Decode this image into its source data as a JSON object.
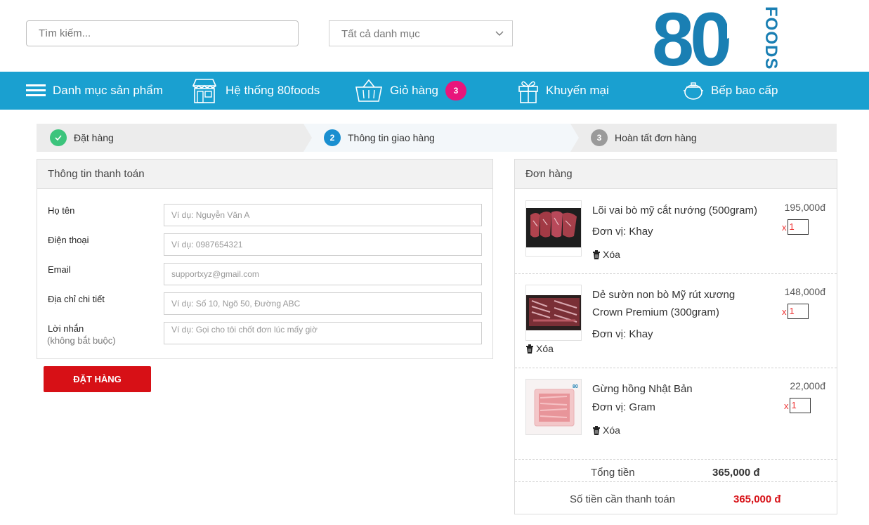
{
  "header": {
    "search_placeholder": "Tìm kiếm...",
    "category_select": "Tất cả danh mục",
    "logo_number": "80",
    "logo_word": "FOODS"
  },
  "nav": {
    "categories": "Danh mục sản phẩm",
    "stores": "Hệ thống 80foods",
    "cart": "Giỏ hàng",
    "cart_count": "3",
    "promotions": "Khuyến mại",
    "kitchen": "Bếp bao cấp"
  },
  "steps": [
    {
      "number": "✓",
      "label": "Đặt hàng"
    },
    {
      "number": "2",
      "label": "Thông tin giao hàng"
    },
    {
      "number": "3",
      "label": "Hoàn tất đơn hàng"
    }
  ],
  "payment": {
    "title": "Thông tin thanh toán",
    "fields": [
      {
        "label": "Họ tên",
        "placeholder": "Ví dụ: Nguyễn Văn A"
      },
      {
        "label": "Điện thoại",
        "placeholder": "Ví dụ: 0987654321"
      },
      {
        "label": "Email",
        "placeholder": "supportxyz@gmail.com"
      },
      {
        "label": "Địa chỉ chi tiết",
        "placeholder": "Ví dụ: Số 10, Ngõ 50, Đường ABC"
      },
      {
        "label": "Lời nhắn",
        "sublabel": "(không bắt buộc)",
        "placeholder": "Ví dụ: Gọi cho tôi chốt đơn lúc mấy giờ"
      }
    ],
    "submit_label": "ĐẶT HÀNG"
  },
  "order": {
    "title": "Đơn hàng",
    "items": [
      {
        "name": "Lõi vai bò mỹ cắt nướng (500gram)",
        "unit": "Đơn vị: Khay",
        "price": "195,000đ",
        "qty_prefix": "x",
        "qty": "1",
        "delete_label": "Xóa"
      },
      {
        "name": "Dẻ sườn non bò Mỹ rút xương Crown Premium (300gram)",
        "unit": "Đơn vị: Khay",
        "price": "148,000đ",
        "qty_prefix": "x",
        "qty": "1",
        "delete_label": "Xóa"
      },
      {
        "name": "Gừng hồng Nhật Bản",
        "unit": "Đơn vị: Gram",
        "price": "22,000đ",
        "qty_prefix": "x",
        "qty": "1",
        "delete_label": "Xóa"
      }
    ],
    "total_label": "Tổng tiền",
    "total_value": "365,000 đ",
    "pay_label": "Số tiền cần thanh toán",
    "pay_value": "365,000 đ"
  },
  "colors": {
    "navbar": "#1aa0d0",
    "badge": "#e8157b",
    "primary_button": "#d71016",
    "step_done": "#3cc47c",
    "step_active": "#1a8fd0",
    "step_pending": "#9a9a9a",
    "logo": "#1a7fb3",
    "total_due": "#d71016"
  }
}
